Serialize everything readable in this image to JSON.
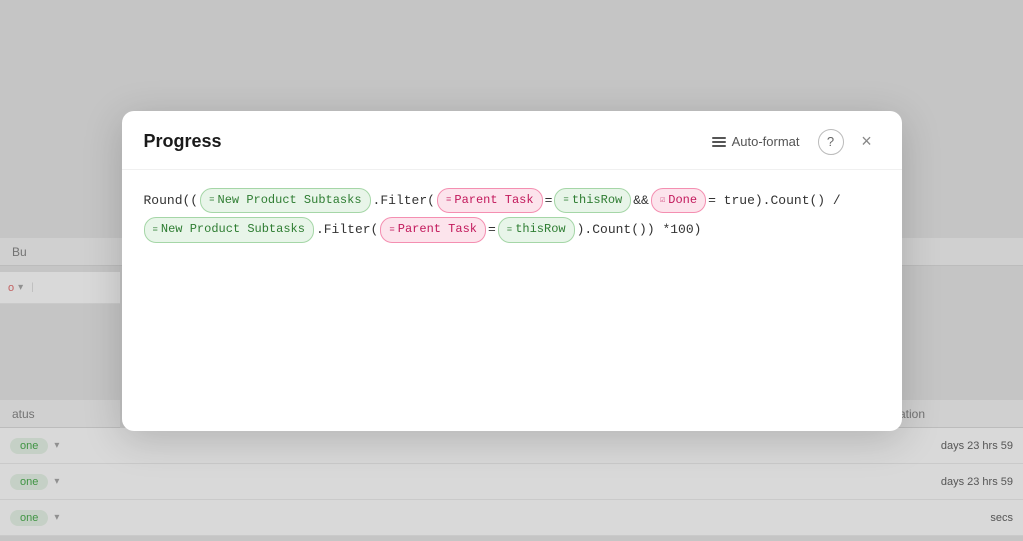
{
  "background": {
    "header_label": "Bu",
    "status_label": "atus",
    "duration_label": "ration",
    "rows": [
      {
        "status": "one",
        "duration": "days 23 hrs 59"
      },
      {
        "status": "one",
        "duration": "days 23 hrs 59"
      },
      {
        "status": "one",
        "duration": "secs"
      }
    ]
  },
  "modal": {
    "title": "Progress",
    "auto_format_label": "Auto-format",
    "help_tooltip": "?",
    "close_label": "×",
    "formula": {
      "line1_pre": "Round((",
      "field1_label": "New Product Subtasks",
      "field1_icon": "≡",
      "filter1": ".Filter(",
      "field2_label": "Parent Task",
      "field2_icon": "≡",
      "equals1": "=",
      "field3_label": "thisRow",
      "field3_icon": "≡",
      "and_op": "&&",
      "field4_label": "Done",
      "field4_icon": "☑",
      "equals2": "= true).Count() /",
      "line2_pre": "",
      "field5_label": "New Product Subtasks",
      "field5_icon": "≡",
      "filter2": ".Filter(",
      "field6_label": "Parent Task",
      "field6_icon": "≡",
      "equals3": "=",
      "field7_label": "thisRow",
      "field7_icon": "≡",
      "suffix": ").Count()) *100)"
    }
  }
}
